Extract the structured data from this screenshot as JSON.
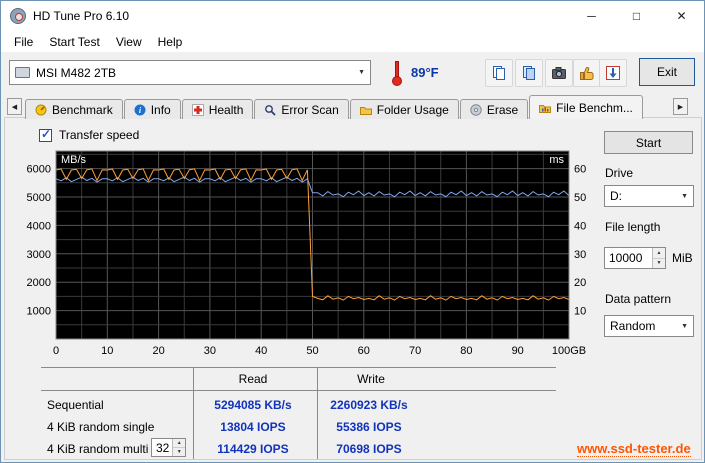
{
  "window": {
    "title": "HD Tune Pro 6.10",
    "minimize_glyph": "─",
    "maximize_glyph": "□",
    "close_glyph": "✕"
  },
  "menu": {
    "items": [
      {
        "label": "File"
      },
      {
        "label": "Start Test"
      },
      {
        "label": "View"
      },
      {
        "label": "Help"
      }
    ]
  },
  "toolbar": {
    "drive_selected": "MSI M482 2TB",
    "temperature": "89°F",
    "exit_label": "Exit"
  },
  "icons": {
    "combo_arrow": "▼",
    "check": "✓",
    "spin_up": "▲",
    "spin_down": "▼",
    "tab_left": "◀",
    "tab_right": "▶"
  },
  "tabs": {
    "active": "File Benchm...",
    "items": [
      {
        "label": "Benchmark"
      },
      {
        "label": "Info"
      },
      {
        "label": "Health"
      },
      {
        "label": "Error Scan"
      },
      {
        "label": "Folder Usage"
      },
      {
        "label": "Erase"
      },
      {
        "label": "File Benchm..."
      }
    ]
  },
  "panel": {
    "transfer_speed_label": "Transfer speed",
    "start_label": "Start",
    "drive_label": "Drive",
    "drive_value": "D:",
    "file_length_label": "File length",
    "file_length_value": "10000",
    "file_length_unit": "MiB",
    "data_pattern_label": "Data pattern",
    "data_pattern_value": "Random"
  },
  "results": {
    "read_header": "Read",
    "write_header": "Write",
    "rows": [
      {
        "label": "Sequential",
        "read": "5294085 KB/s",
        "write": "2260923 KB/s"
      },
      {
        "label": "4 KiB random single",
        "read": "13804 IOPS",
        "write": "55386 IOPS"
      },
      {
        "label": "4 KiB random multi",
        "spinner": "32",
        "read": "114429 IOPS",
        "write": "70698 IOPS"
      }
    ]
  },
  "footer": {
    "website": "www.ssd-tester.de"
  },
  "chart_data": {
    "type": "line",
    "title": "File Benchmark transfer speed over 100 GB",
    "x_unit": "GB",
    "xlim": [
      0,
      100
    ],
    "x_step": 1,
    "x_ticks": [
      0,
      10,
      20,
      30,
      40,
      50,
      60,
      70,
      80,
      90,
      100
    ],
    "x_tick_labels": [
      "0",
      "10",
      "20",
      "30",
      "40",
      "50",
      "60",
      "70",
      "80",
      "90",
      "100GB"
    ],
    "y_left": {
      "label": "MB/s",
      "lim": [
        0,
        6620
      ],
      "ticks": [
        1000,
        2000,
        3000,
        4000,
        5000,
        6000
      ]
    },
    "y_right": {
      "label": "ms",
      "lim": [
        0,
        66.2
      ],
      "ticks": [
        10,
        20,
        30,
        40,
        50,
        60
      ]
    },
    "grid": {
      "x_step": 5,
      "y_step": 500,
      "color_minor": "#3a3a3a",
      "color_major": "#555555"
    },
    "plot_bg": "#000000",
    "legend_position": "none",
    "series": [
      {
        "name": "read",
        "color": "#7fa8f0",
        "values": [
          5640,
          5570,
          5680,
          5540,
          5620,
          5700,
          5580,
          5660,
          5520,
          5640,
          5640,
          5570,
          5680,
          5540,
          5620,
          5700,
          5580,
          5660,
          5520,
          5640,
          5640,
          5570,
          5680,
          5540,
          5620,
          5700,
          5580,
          5660,
          5520,
          5640,
          5640,
          5570,
          5680,
          5540,
          5620,
          5700,
          5580,
          5660,
          5520,
          5640,
          5640,
          5570,
          5680,
          5540,
          5620,
          5700,
          5580,
          5660,
          5520,
          5640,
          5150,
          5150,
          5040,
          5190,
          5070,
          5110,
          5010,
          5170,
          5080,
          5210,
          5050,
          5150,
          5040,
          5190,
          5070,
          5110,
          5010,
          5170,
          5080,
          5210,
          5050,
          5150,
          5040,
          5190,
          5070,
          5110,
          5010,
          5170,
          5080,
          5210,
          5050,
          5150,
          5040,
          5190,
          5070,
          5110,
          5010,
          5170,
          5080,
          5210,
          5050,
          5150,
          5040,
          5190,
          5070,
          5110,
          5010,
          5170,
          5080,
          5210,
          5050
        ]
      },
      {
        "name": "write",
        "color": "#ffa033",
        "values": [
          5950,
          5985,
          5620,
          5950,
          5975,
          5650,
          5960,
          5990,
          5580,
          5955,
          5950,
          5985,
          5620,
          5950,
          5975,
          5650,
          5960,
          5990,
          5580,
          5955,
          5950,
          5985,
          5620,
          5950,
          5975,
          5650,
          5960,
          5990,
          5580,
          5955,
          5950,
          5985,
          5620,
          5950,
          5975,
          5650,
          5960,
          5990,
          5580,
          5955,
          5950,
          5985,
          5620,
          5950,
          5975,
          5650,
          5960,
          5990,
          5580,
          5955,
          1500,
          1430,
          1380,
          1520,
          1400,
          1450,
          1370,
          1500,
          1420,
          1460,
          1390,
          1430,
          1380,
          1520,
          1400,
          1450,
          1370,
          1500,
          1420,
          1460,
          1390,
          1430,
          1380,
          1520,
          1400,
          1450,
          1370,
          1500,
          1420,
          1460,
          1390,
          1430,
          1380,
          1520,
          1400,
          1450,
          1370,
          1500,
          1420,
          1460,
          1390,
          1430,
          1380,
          1520,
          1400,
          1450,
          1370,
          1500,
          1420,
          1460,
          1390
        ]
      }
    ]
  }
}
